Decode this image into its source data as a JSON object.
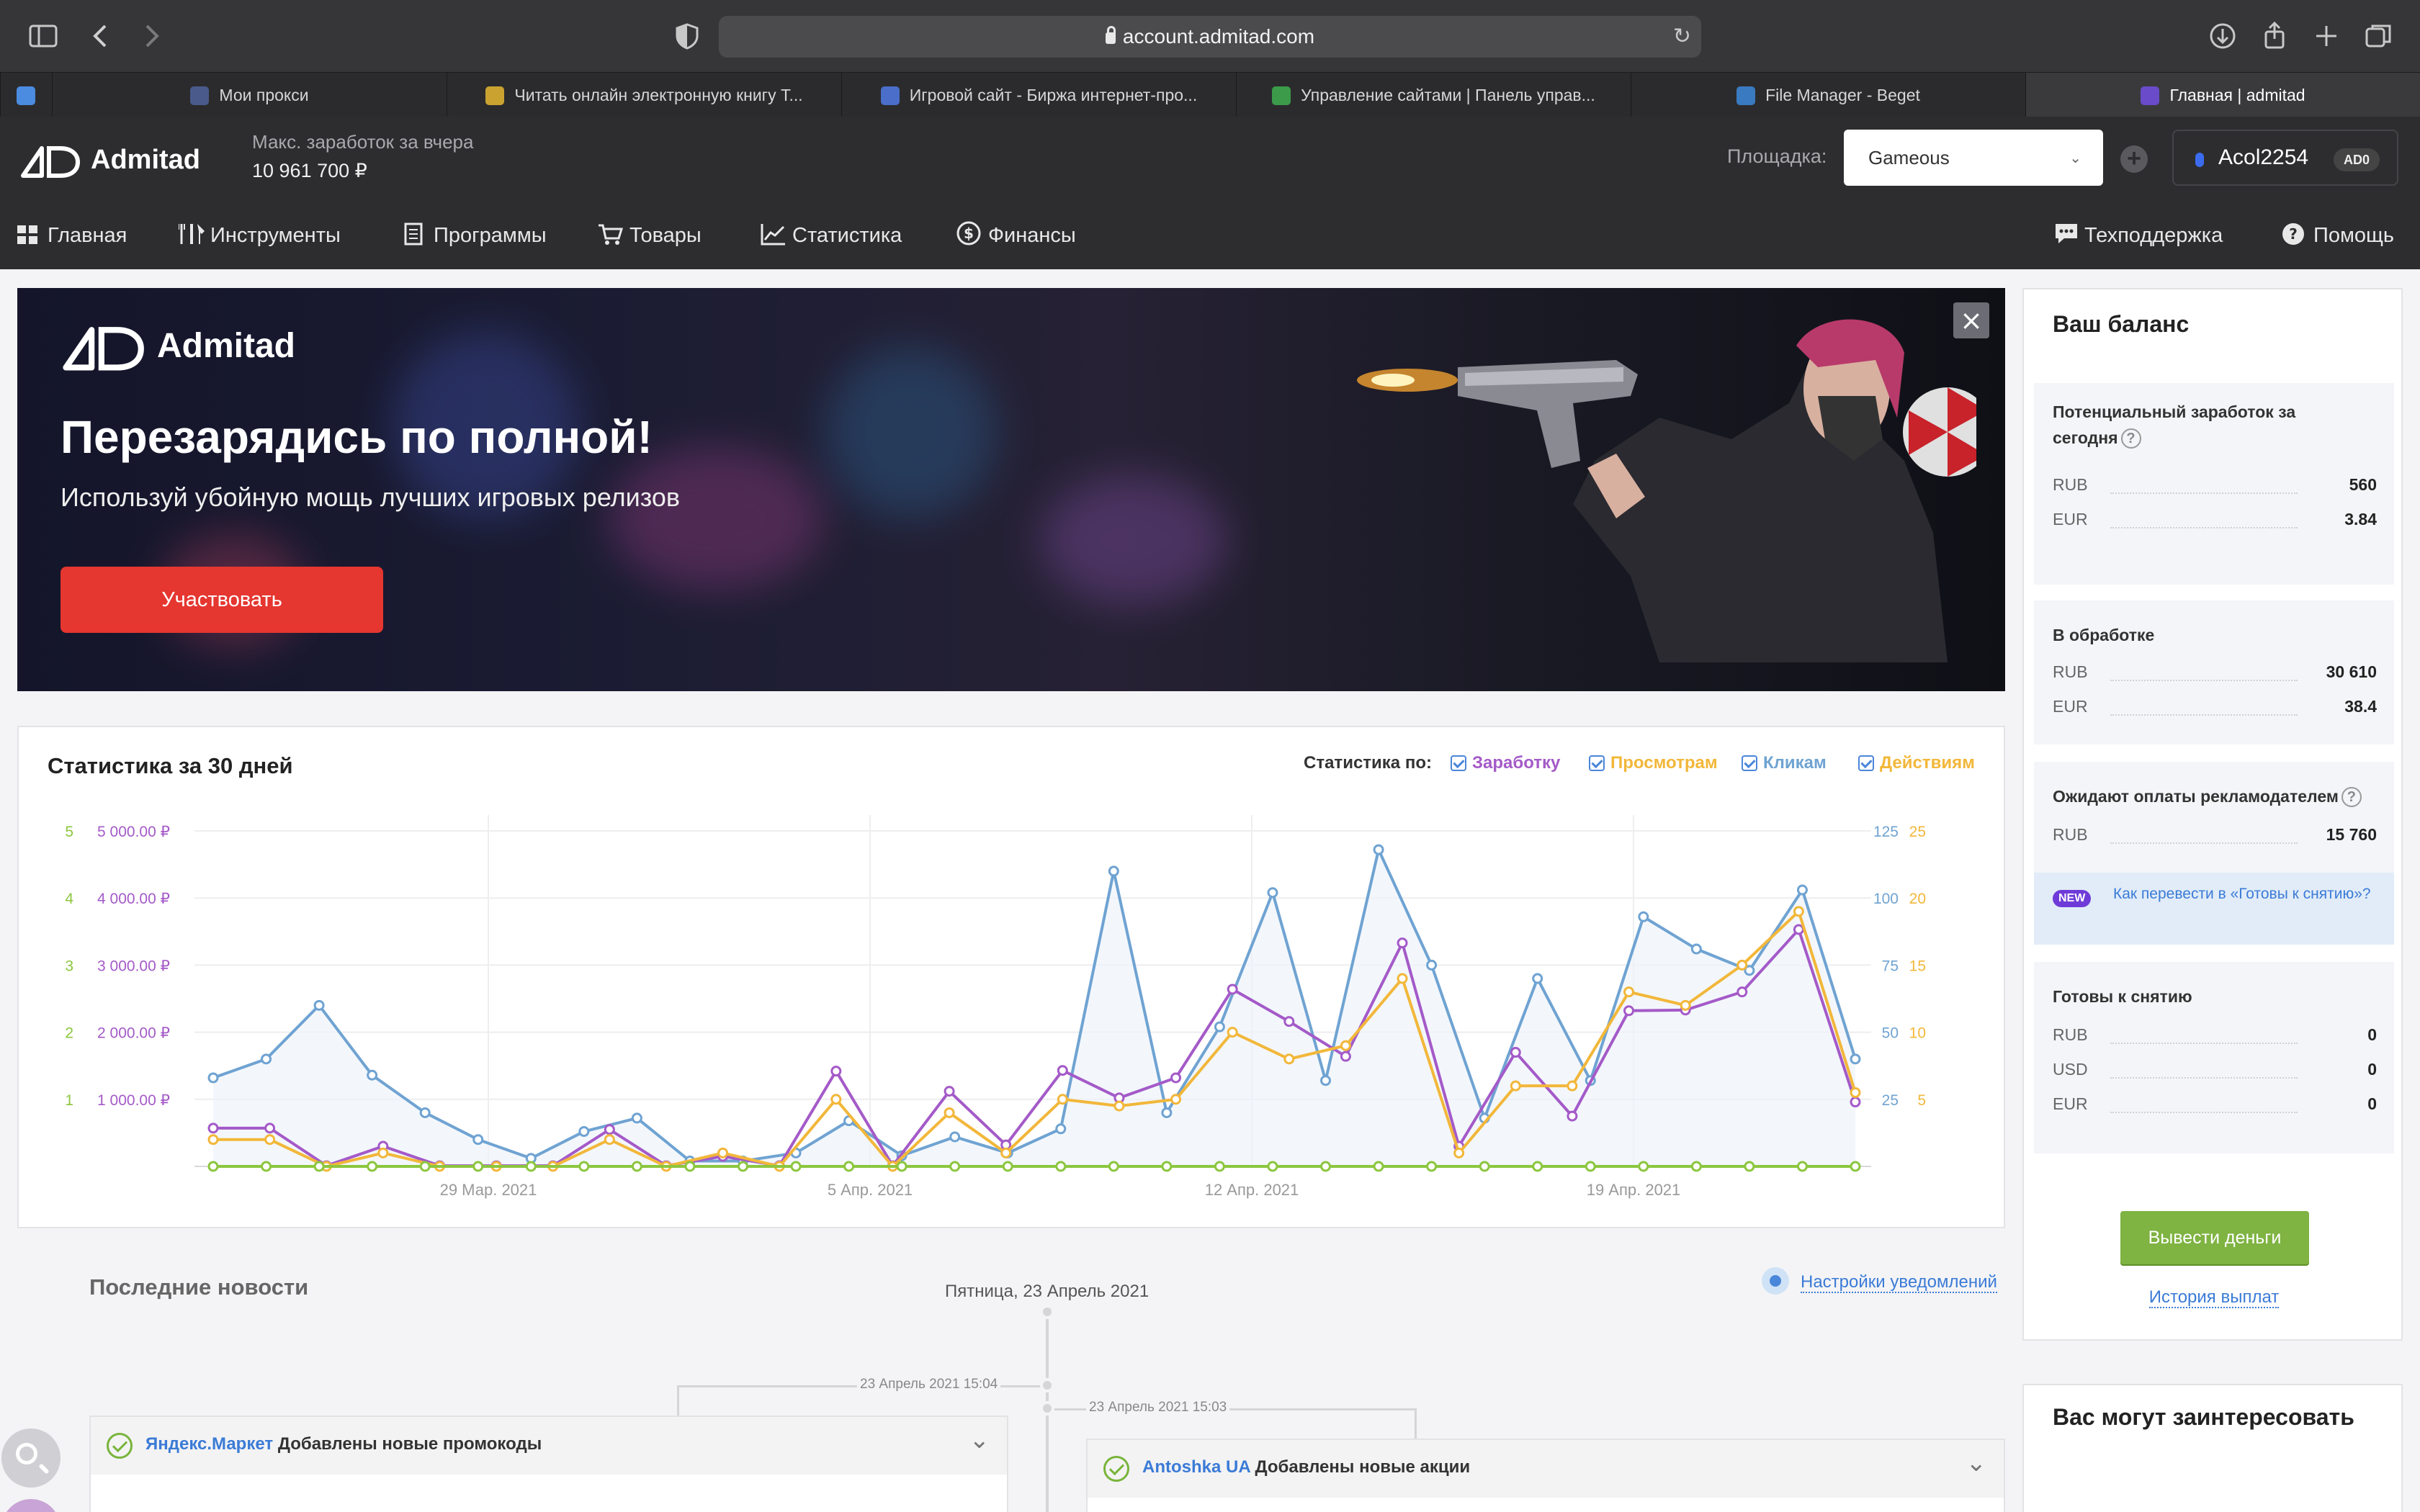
{
  "browser": {
    "url": "account.admitad.com",
    "tabs": [
      {
        "label": "Мои прокси",
        "favicon_color": "#4a5a8a"
      },
      {
        "label": "Читать онлайн электронную книгу Т...",
        "favicon_color": "#c9a230"
      },
      {
        "label": "Игровой сайт - Биржа интернет-про...",
        "favicon_color": "#4a6ec9"
      },
      {
        "label": "Управление сайтами | Панель управ...",
        "favicon_color": "#3b9b4a"
      },
      {
        "label": "File Manager - Beget",
        "favicon_color": "#3a7ac0"
      },
      {
        "label": "Главная | admitad",
        "favicon_color": "#6a4bc9",
        "active": true
      }
    ]
  },
  "header": {
    "logo": "Admitad",
    "max_earn_label": "Макс. заработок за вчера",
    "max_earn_value": "10 961 700 ₽",
    "platform_label": "Площадка:",
    "platform_value": "Gameous",
    "user_name": "Acol2254",
    "user_badge": "AD0"
  },
  "nav": {
    "items": [
      {
        "label": "Главная",
        "icon": "grid-icon"
      },
      {
        "label": "Инструменты",
        "icon": "tools-icon"
      },
      {
        "label": "Программы",
        "icon": "document-icon"
      },
      {
        "label": "Товары",
        "icon": "cart-icon"
      },
      {
        "label": "Статистика",
        "icon": "chart-icon"
      },
      {
        "label": "Финансы",
        "icon": "dollar-icon"
      }
    ],
    "support": "Техподдержка",
    "help": "Помощь"
  },
  "banner": {
    "logo": "Admitad",
    "title": "Перезарядись по полной!",
    "subtitle": "Используй убойную мощь лучших игровых релизов",
    "cta": "Участвовать"
  },
  "stats": {
    "title": "Статистика за 30 дней",
    "by_label": "Статистика по:",
    "legend": [
      {
        "label": "Заработку",
        "color": "#a45ac8"
      },
      {
        "label": "Просмотрам",
        "color": "#f2b73a"
      },
      {
        "label": "Кликам",
        "color": "#6fa3d2"
      },
      {
        "label": "Действиям",
        "color": "#f2b73a"
      }
    ]
  },
  "chart_data": {
    "type": "line",
    "x_ticks": [
      "29 Мар. 2021",
      "5 Апр. 2021",
      "12 Апр. 2021",
      "19 Апр. 2021"
    ],
    "left_axis_actions": [
      "1",
      "2",
      "3",
      "4",
      "5"
    ],
    "left_axis_earnings": [
      "1 000.00 ₽",
      "2 000.00 ₽",
      "3 000.00 ₽",
      "4 000.00 ₽",
      "5 000.00 ₽"
    ],
    "right_axis_clicks": [
      "25",
      "50",
      "75",
      "100",
      "125"
    ],
    "right_axis_views": [
      "5",
      "10",
      "15",
      "20",
      "25"
    ],
    "grid": true,
    "series": [
      {
        "name": "Кликам",
        "color": "#6fa3d2",
        "values": [
          33,
          40,
          60,
          34,
          20,
          10,
          3,
          13,
          18,
          2,
          2,
          5,
          17,
          4,
          11,
          5,
          14,
          110,
          20,
          52,
          102,
          32,
          118,
          75,
          18,
          70,
          32,
          93,
          81,
          73,
          103,
          40
        ]
      },
      {
        "name": "Заработку",
        "color": "#a45ac8",
        "values": [
          570,
          570,
          10,
          300,
          10,
          10,
          10,
          550,
          10,
          150,
          10,
          1420,
          10,
          1120,
          320,
          1430,
          1020,
          1320,
          2640,
          2160,
          1640,
          3330,
          300,
          1700,
          750,
          2320,
          2330,
          2600,
          3530,
          960
        ]
      },
      {
        "name": "Просмотрам",
        "color": "#f2b73a",
        "values": [
          4,
          4,
          0,
          2,
          0,
          0,
          0,
          4,
          0,
          2,
          0,
          10,
          0,
          8,
          2,
          10,
          9,
          10,
          20,
          16,
          18,
          28,
          2,
          12,
          12,
          26,
          24,
          30,
          38,
          11
        ]
      },
      {
        "name": "Действиям",
        "color": "#8cc63f",
        "values": [
          0,
          0,
          0,
          0,
          0,
          0,
          0,
          0,
          0,
          0,
          0,
          0,
          0,
          0,
          0,
          0,
          0,
          0,
          0,
          0,
          0,
          0,
          0,
          0,
          0,
          0,
          0,
          0,
          0,
          0,
          0,
          0
        ]
      }
    ]
  },
  "news": {
    "title": "Последние новости",
    "date": "Пятница, 23 Апрель 2021",
    "settings": "Настройки уведомлений",
    "items": [
      {
        "time": "23 Апрель 2021 15:04",
        "source": "Яндекс.Маркет",
        "text": "Добавлены новые промокоды"
      },
      {
        "time": "23 Апрель 2021 15:03",
        "source": "Antoshka UA",
        "text": "Добавлены новые акции"
      }
    ]
  },
  "balance": {
    "title": "Ваш баланс",
    "potential": {
      "label": "Потенциальный заработок за сегодня",
      "rows": [
        {
          "cur": "RUB",
          "val": "560"
        },
        {
          "cur": "EUR",
          "val": "3.84"
        }
      ]
    },
    "processing": {
      "label": "В обработке",
      "rows": [
        {
          "cur": "RUB",
          "val": "30 610"
        },
        {
          "cur": "EUR",
          "val": "38.4"
        }
      ]
    },
    "awaiting": {
      "label": "Ожидают оплаты рекламодателем",
      "rows": [
        {
          "cur": "RUB",
          "val": "15 760"
        }
      ]
    },
    "howto_badge": "NEW",
    "howto": "Как перевести в «Готовы к снятию»?",
    "ready": {
      "label": "Готовы к снятию",
      "rows": [
        {
          "cur": "RUB",
          "val": "0"
        },
        {
          "cur": "USD",
          "val": "0"
        },
        {
          "cur": "EUR",
          "val": "0"
        }
      ]
    },
    "withdraw": "Вывести деньги",
    "history": "История выплат"
  },
  "interest": {
    "title": "Вас могут заинтересовать"
  }
}
